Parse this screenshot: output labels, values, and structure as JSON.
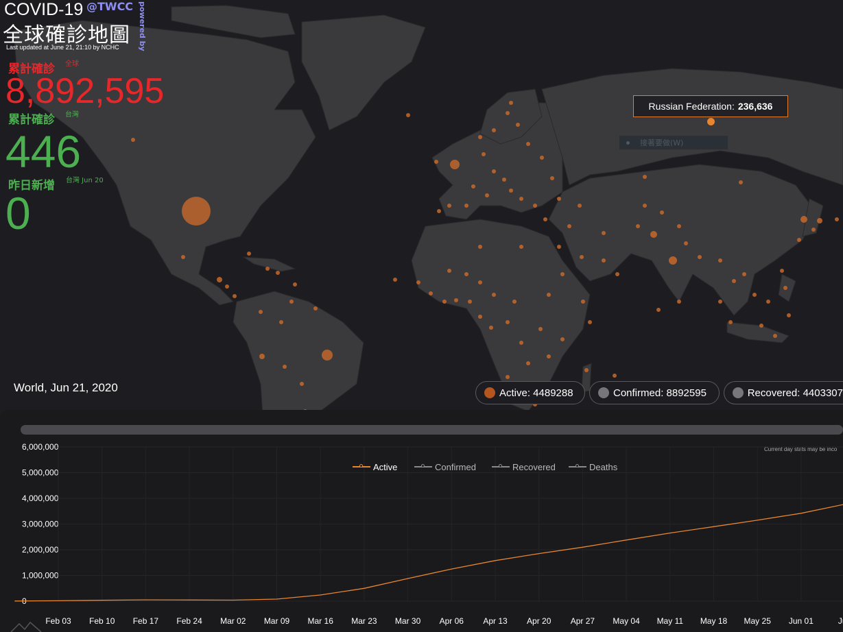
{
  "header": {
    "title": "COVID-19",
    "twcc": "@TWCC",
    "powered": "powered by",
    "title_cn": "全球確診地圖",
    "updated": "Last updated at June 21, 21:10 by NCHC"
  },
  "stats": {
    "global_label": "累計確診",
    "global_sub": "全球",
    "global_value": "8,892,595",
    "tw_label": "累計確診",
    "tw_sub": "台灣",
    "tw_value": "446",
    "new_label": "昨日新增",
    "new_sub": "台灣 Jun 20",
    "new_value": "0"
  },
  "tooltip": {
    "country": "Russian Federation:",
    "value": "236,636"
  },
  "ghost_pill": "接著要做(W)",
  "world_date": "World, Jun 21, 2020",
  "pills": [
    {
      "label": "Active: 4489288",
      "color": "#b5561f"
    },
    {
      "label": "Confirmed: 8892595",
      "color": "#77777b"
    },
    {
      "label": "Recovered: 4403307",
      "color": "#77777b"
    }
  ],
  "chart_note": "Current day stats may be inco",
  "colors": {
    "accent": "#e8862f",
    "bubble": "#c8692a",
    "land": "#3a3a3d",
    "ocean": "#1d1d21"
  },
  "chart_data": {
    "type": "line",
    "ylabels": [
      "6,000,000",
      "5,000,000",
      "4,000,000",
      "3,000,000",
      "2,000,000",
      "1,000,000",
      "0"
    ],
    "ylim": [
      0,
      6000000
    ],
    "x_ticks": [
      "Feb 03",
      "Feb 10",
      "Feb 17",
      "Feb 24",
      "Mar 02",
      "Mar 09",
      "Mar 16",
      "Mar 23",
      "Mar 30",
      "Apr 06",
      "Apr 13",
      "Apr 20",
      "Apr 27",
      "May 04",
      "May 11",
      "May 18",
      "May 25",
      "Jun 01",
      "Jun"
    ],
    "legend": [
      {
        "name": "Active",
        "color": "#e8862f"
      },
      {
        "name": "Confirmed",
        "color": "#8a8a8e"
      },
      {
        "name": "Recovered",
        "color": "#8a8a8e"
      },
      {
        "name": "Deaths",
        "color": "#8a8a8e"
      }
    ],
    "series": [
      {
        "name": "Active",
        "x": [
          "Jan 27",
          "Feb 03",
          "Feb 10",
          "Feb 17",
          "Feb 24",
          "Mar 02",
          "Mar 09",
          "Mar 16",
          "Mar 23",
          "Mar 30",
          "Apr 06",
          "Apr 13",
          "Apr 20",
          "Apr 27",
          "May 04",
          "May 11",
          "May 18",
          "May 25",
          "Jun 01",
          "Jun 08"
        ],
        "values": [
          5000,
          15000,
          35000,
          50000,
          45000,
          40000,
          80000,
          240000,
          500000,
          880000,
          1250000,
          1580000,
          1850000,
          2100000,
          2380000,
          2650000,
          2900000,
          3150000,
          3420000,
          3770000
        ]
      }
    ]
  }
}
